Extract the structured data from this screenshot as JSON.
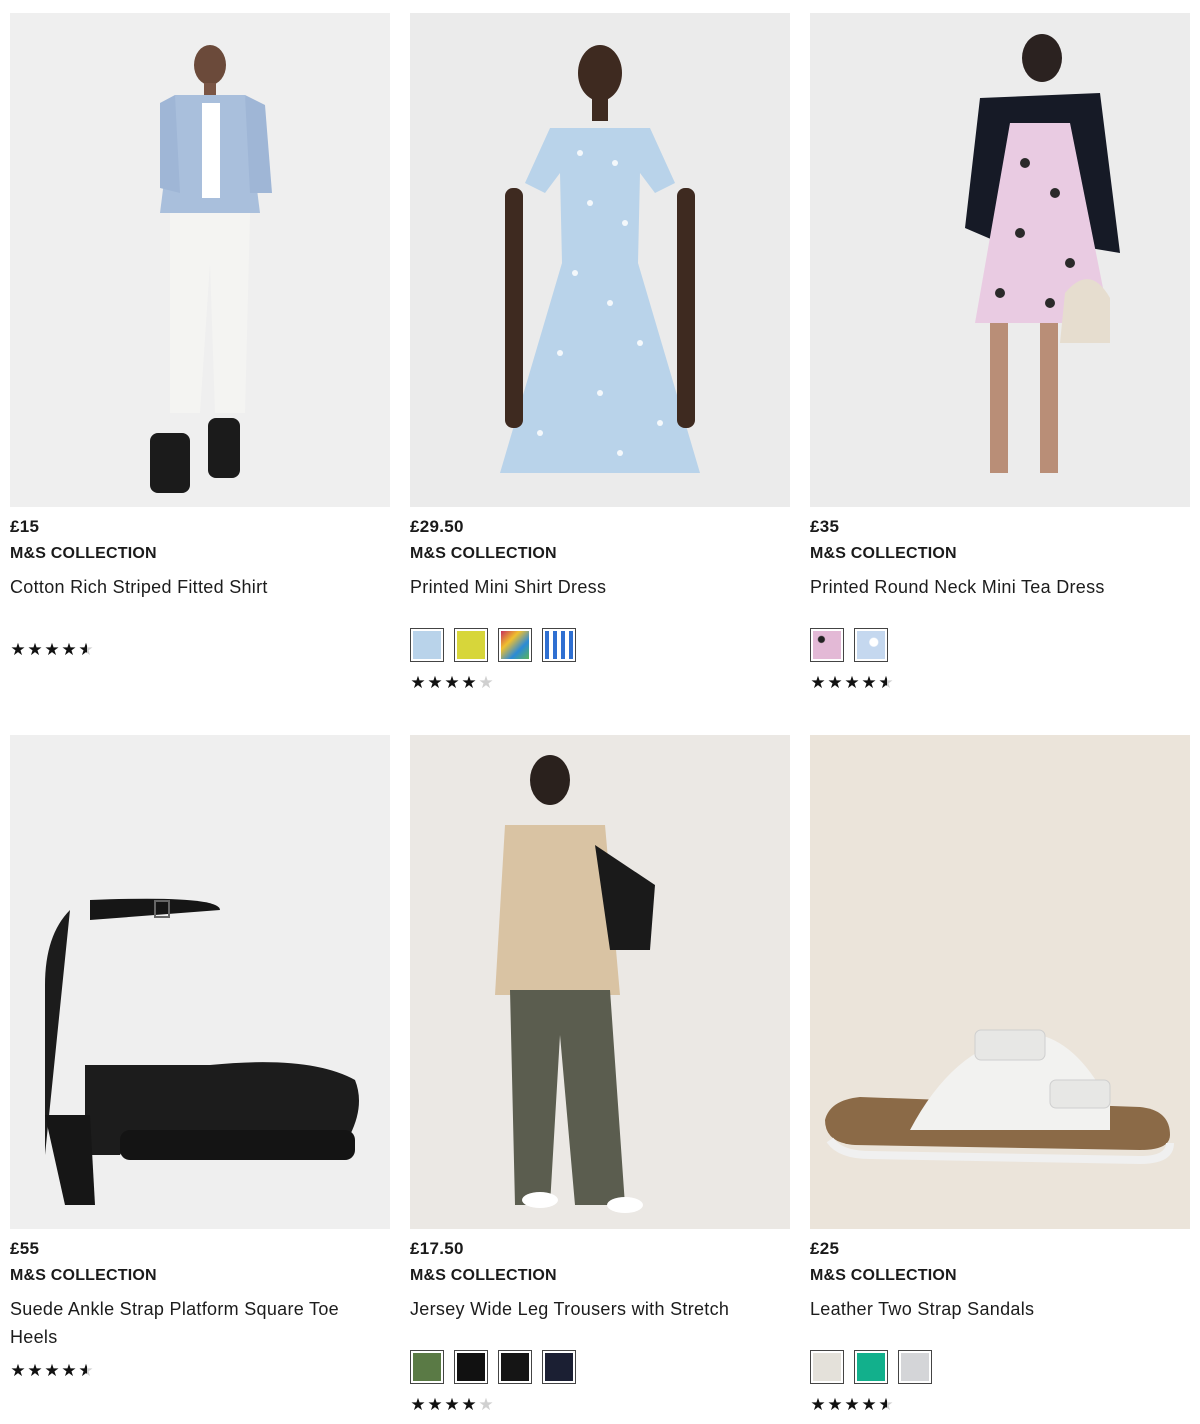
{
  "products": [
    {
      "price": "£15",
      "brand": "M&S COLLECTION",
      "title": "Cotton Rich Striped Fitted Shirt",
      "swatches": [],
      "rating": 4.5,
      "image": "woman-striped-shirt-white-jeans"
    },
    {
      "price": "£29.50",
      "brand": "M&S COLLECTION",
      "title": "Printed Mini Shirt Dress",
      "swatches": [
        "#b9d3ea",
        "#d7d63a",
        "#c8325a",
        "#2f6fd1"
      ],
      "rating": 4,
      "image": "woman-blue-polka-dot-dress"
    },
    {
      "price": "£35",
      "brand": "M&S COLLECTION",
      "title": "Printed Round Neck Mini Tea Dress",
      "swatches": [
        "#e3b9d6",
        "#c5d8ef"
      ],
      "rating": 4.5,
      "image": "woman-floral-dress-black-blazer"
    },
    {
      "price": "£55",
      "brand": "M&S COLLECTION",
      "title": "Suede Ankle Strap Platform Square Toe Heels",
      "swatches": [],
      "rating": 4.5,
      "image": "black-suede-platform-heel"
    },
    {
      "price": "£17.50",
      "brand": "M&S COLLECTION",
      "title": "Jersey Wide Leg Trousers with Stretch",
      "swatches": [
        "#5a7a45",
        "#111111",
        "#151515",
        "#1b1f33"
      ],
      "rating": 4,
      "image": "woman-wide-leg-trousers"
    },
    {
      "price": "£25",
      "brand": "M&S COLLECTION",
      "title": "Leather Two Strap Sandals",
      "swatches": [
        "#e4e1da",
        "#12b08c",
        "#d4d5d8"
      ],
      "rating": 4.5,
      "image": "white-two-strap-sandal"
    }
  ]
}
